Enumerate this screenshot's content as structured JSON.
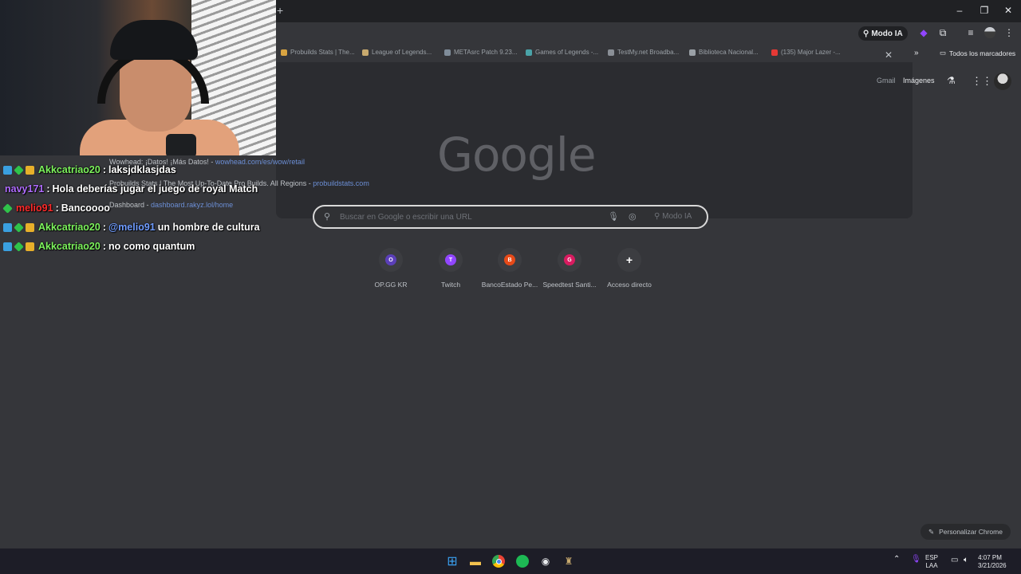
{
  "browser": {
    "new_tab_glyph": "+",
    "modo_ia_label": "Modo IA",
    "bookmarks": [
      {
        "label": "Probuilds Stats | The...",
        "color": "#d9a441"
      },
      {
        "label": "League of Legends...",
        "color": "#c8aa6e"
      },
      {
        "label": "METAsrc Patch 9.23...",
        "color": "#7f8c99"
      },
      {
        "label": "Games of Legends -...",
        "color": "#4aa3a8"
      },
      {
        "label": "TestMy.net Broadba...",
        "color": "#8a8f96"
      },
      {
        "label": "Biblioteca Nacional...",
        "color": "#9aa0a6"
      },
      {
        "label": "(135) Major Lazer -...",
        "color": "#e53935"
      }
    ],
    "all_bookmarks_label": "Todos los marcadores"
  },
  "newtab": {
    "gmail_label": "Gmail",
    "images_label": "Imágenes",
    "logo_text": "Google",
    "search_placeholder": "Buscar en Google o escribir una URL",
    "search_modo_label": "Modo IA",
    "suggestions": [
      {
        "title": "Wowhead: ¡Datos! ¡Más Datos!",
        "url": "wowhead.com/es/wow/retail"
      },
      {
        "title": "Probuilds Stats | The Most Up-To-Date Pro Builds. All Regions",
        "url": "probuildstats.com"
      },
      {
        "title": "Dashboard",
        "url": "dashboard.rakyz.lol/home"
      }
    ],
    "shortcuts": [
      {
        "label": "OP.GG KR",
        "glyph": "O",
        "color": "#5b3fb8"
      },
      {
        "label": "Twitch",
        "glyph": "T",
        "color": "#9146ff"
      },
      {
        "label": "BancoEstado Pe...",
        "glyph": "B",
        "color": "#e64a19"
      },
      {
        "label": "Speedtest Santi...",
        "glyph": "G",
        "color": "#d81b60"
      },
      {
        "label": "Acceso directo",
        "glyph": "+",
        "color": "#3c3d41"
      }
    ],
    "customize_label": "Personalizar Chrome"
  },
  "chat": [
    {
      "user": "Akkcatriao20",
      "user_color": "#7cf25c",
      "message": "laksjdklasjdas",
      "mention": "",
      "badges": [
        "blue",
        "green",
        "gold"
      ]
    },
    {
      "user": "navy171",
      "user_color": "#b06cff",
      "message": "Hola deberías jugar el juego de royal Match",
      "mention": "",
      "badges": []
    },
    {
      "user": "melio91",
      "user_color": "#ff2a2a",
      "message": "Bancoooo",
      "mention": "",
      "badges": [
        "green"
      ]
    },
    {
      "user": "Akkcatriao20",
      "user_color": "#7cf25c",
      "message": "un hombre de cultura",
      "mention": "@melio91",
      "badges": [
        "blue",
        "green",
        "gold"
      ]
    },
    {
      "user": "Akkcatriao20",
      "user_color": "#7cf25c",
      "message": "no como quantum",
      "mention": "",
      "badges": [
        "blue",
        "green",
        "gold"
      ]
    }
  ],
  "taskbar": {
    "lang_top": "ESP",
    "lang_bottom": "LAA",
    "time": "4:07 PM",
    "date": "3/21/2026"
  }
}
